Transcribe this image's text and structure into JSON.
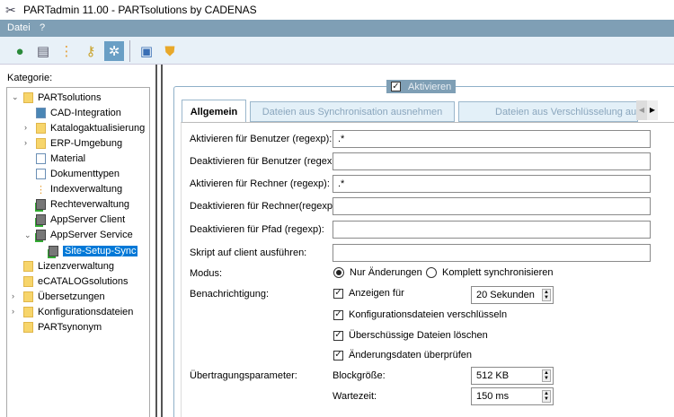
{
  "window": {
    "title": "PARTadmin 11.00 - PARTsolutions by CADENAS"
  },
  "menu": [
    "Datei",
    "?"
  ],
  "toolbar": [
    "globe-icon",
    "printer-icon",
    "hierarchy-icon",
    "keys-icon",
    "settings-icon",
    "save-icon",
    "shield-icon"
  ],
  "left": {
    "label": "Kategorie:",
    "tree": [
      {
        "label": "PARTsolutions",
        "icon": "folder",
        "level": 0,
        "exp": "v"
      },
      {
        "label": "CAD-Integration",
        "icon": "cad",
        "level": 1
      },
      {
        "label": "Katalogaktualisierung",
        "icon": "folder",
        "level": 1,
        "exp": ">"
      },
      {
        "label": "ERP-Umgebung",
        "icon": "folder",
        "level": 1,
        "exp": ">"
      },
      {
        "label": "Material",
        "icon": "doc",
        "level": 1
      },
      {
        "label": "Dokumenttypen",
        "icon": "doc",
        "level": 1
      },
      {
        "label": "Indexverwaltung",
        "icon": "index",
        "level": 1
      },
      {
        "label": "Rechteverwaltung",
        "icon": "server",
        "level": 1
      },
      {
        "label": "AppServer Client",
        "icon": "server",
        "level": 1
      },
      {
        "label": "AppServer Service",
        "icon": "server",
        "level": 1,
        "exp": "v"
      },
      {
        "label": "Site-Setup-Sync",
        "icon": "server",
        "level": 2,
        "selected": true
      },
      {
        "label": "Lizenzverwaltung",
        "icon": "folder",
        "level": 0
      },
      {
        "label": "eCATALOGsolutions",
        "icon": "folder",
        "level": 0
      },
      {
        "label": "Übersetzungen",
        "icon": "folder",
        "level": 0,
        "exp": ">"
      },
      {
        "label": "Konfigurationsdateien",
        "icon": "folder",
        "level": 0,
        "exp": ">"
      },
      {
        "label": "PARTsynonym",
        "icon": "folder",
        "level": 0
      }
    ]
  },
  "group": {
    "activate_label": "Aktivieren",
    "activate_checked": true
  },
  "tabs": [
    "Allgemein",
    "Dateien aus Synchronisation ausnehmen",
    "Dateien aus Verschlüsselung ausnehmen"
  ],
  "form": {
    "fields": [
      {
        "label": "Aktivieren für Benutzer (regexp):",
        "value": ".*"
      },
      {
        "label": "Deaktivieren für Benutzer (regexp):",
        "value": ""
      },
      {
        "label": "Aktivieren für Rechner (regexp):",
        "value": ".*"
      },
      {
        "label": "Deaktivieren für Rechner(regexp):",
        "value": ""
      },
      {
        "label": "Deaktivieren für Pfad (regexp):",
        "value": ""
      },
      {
        "label": "Skript auf client ausführen:",
        "value": ""
      }
    ],
    "modus_label": "Modus:",
    "modus_options": [
      "Nur Änderungen",
      "Komplett synchronisieren"
    ],
    "modus_selected": 0,
    "notif_label": "Benachrichtigung:",
    "show_for_label": "Anzeigen für",
    "show_for_value": "20 Sekunden",
    "checks": [
      "Konfigurationsdateien verschlüsseln",
      "Überschüssige Dateien löschen",
      "Änderungsdaten überprüfen"
    ],
    "transfer_label": "Übertragungsparameter:",
    "block_label": "Blockgröße:",
    "block_value": "512 KB",
    "wait_label": "Wartezeit:",
    "wait_value": "150 ms"
  }
}
